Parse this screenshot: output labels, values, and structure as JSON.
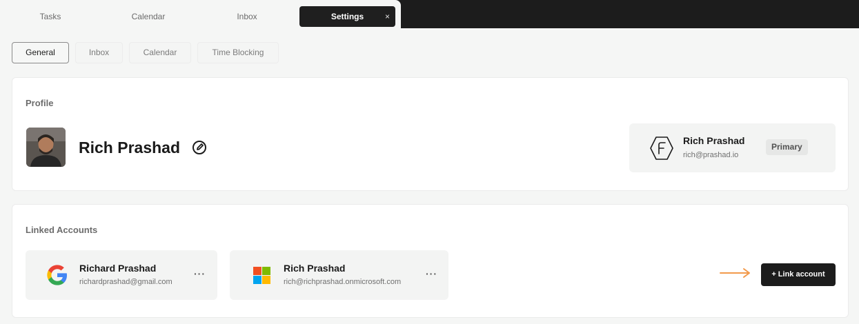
{
  "top_tabs": [
    {
      "label": "Tasks"
    },
    {
      "label": "Calendar"
    },
    {
      "label": "Inbox"
    },
    {
      "label": "Settings",
      "close": "×"
    }
  ],
  "sub_tabs": [
    {
      "label": "General"
    },
    {
      "label": "Inbox"
    },
    {
      "label": "Calendar"
    },
    {
      "label": "Time Blocking"
    }
  ],
  "profile": {
    "section_title": "Profile",
    "name": "Rich Prashad",
    "avatar_icon": "avatar-photo",
    "edit_icon": "edit-icon",
    "primary_account": {
      "name": "Rich Prashad",
      "email": "rich@prashad.io",
      "badge": "Primary",
      "icon": "app-logo-icon"
    }
  },
  "linked_accounts": {
    "section_title": "Linked Accounts",
    "accounts": [
      {
        "provider": "google-icon",
        "name": "Richard Prashad",
        "email": "richardprashad@gmail.com",
        "more": "···"
      },
      {
        "provider": "microsoft-icon",
        "name": "Rich Prashad",
        "email": "rich@richprashad.onmicrosoft.com",
        "more": "···"
      }
    ],
    "link_button": "+ Link account",
    "arrow_color": "#f2994a"
  },
  "colors": {
    "accent_dark": "#1c1c1c",
    "background": "#f5f6f5",
    "google_blue": "#4285F4",
    "google_red": "#EA4335",
    "google_yellow": "#FBBC05",
    "google_green": "#34A853",
    "ms_red": "#F25022",
    "ms_green": "#7FBA00",
    "ms_blue": "#00A4EF",
    "ms_yellow": "#FFB900"
  }
}
